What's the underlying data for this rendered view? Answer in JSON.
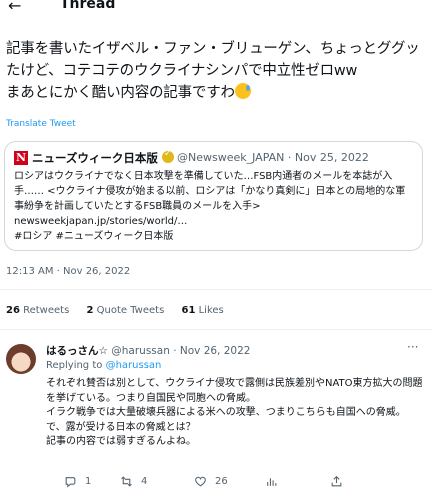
{
  "header": {
    "title": "Thread"
  },
  "tweet": {
    "text": "記事を書いたイザベル・ファン・ブリューゲン、ちょっとググッたけど、コテコテのウクライナシンパで中立性ゼロww\nまあとにかく酷い内容の記事ですわ",
    "translate_label": "Translate Tweet",
    "timestamp": "12:13 AM · Nov 26, 2022"
  },
  "quote": {
    "logo_letter": "N",
    "name": "ニューズウィーク日本版",
    "handle": "@Newsweek_JAPAN · Nov 25, 2022",
    "body": "ロシアはウクライナでなく日本攻撃を準備していた…FSB内通者のメールを本誌が入手…… <ウクライナ侵攻が始まる以前、ロシアは「かなり真剣に」日本との局地的な軍事紛争を計画していたとするFSB職員のメールを入手>\nnewsweekjapan.jp/stories/world/…\n#ロシア #ニューズウィーク日本版"
  },
  "stats": {
    "retweets_count": "26",
    "retweets_label": "Retweets",
    "quotes_count": "2",
    "quotes_label": "Quote Tweets",
    "likes_count": "61",
    "likes_label": "Likes"
  },
  "reply": {
    "name": "はるっさん☆",
    "meta": "@harussan · Nov 26, 2022",
    "replying_label": "Replying to",
    "replying_handle": "@harussan",
    "body": "それぞれ賛否は別として、ウクライナ侵攻で露側は民族差別やNATO東方拡大の問題を挙げている。つまり自国民や同胞への脅威。\nイラク戦争では大量破壊兵器による米への攻撃、つまりこちらも自国への脅威。\nで、露が受ける日本の脅威とは？\n記事の内容では弱すぎるんよね。",
    "actions": {
      "reply_count": "1",
      "retweet_count": "4",
      "like_count": "26"
    }
  },
  "colors": {
    "accent": "#1d9bf0",
    "muted": "#536471",
    "logo_red": "#d0021b"
  }
}
